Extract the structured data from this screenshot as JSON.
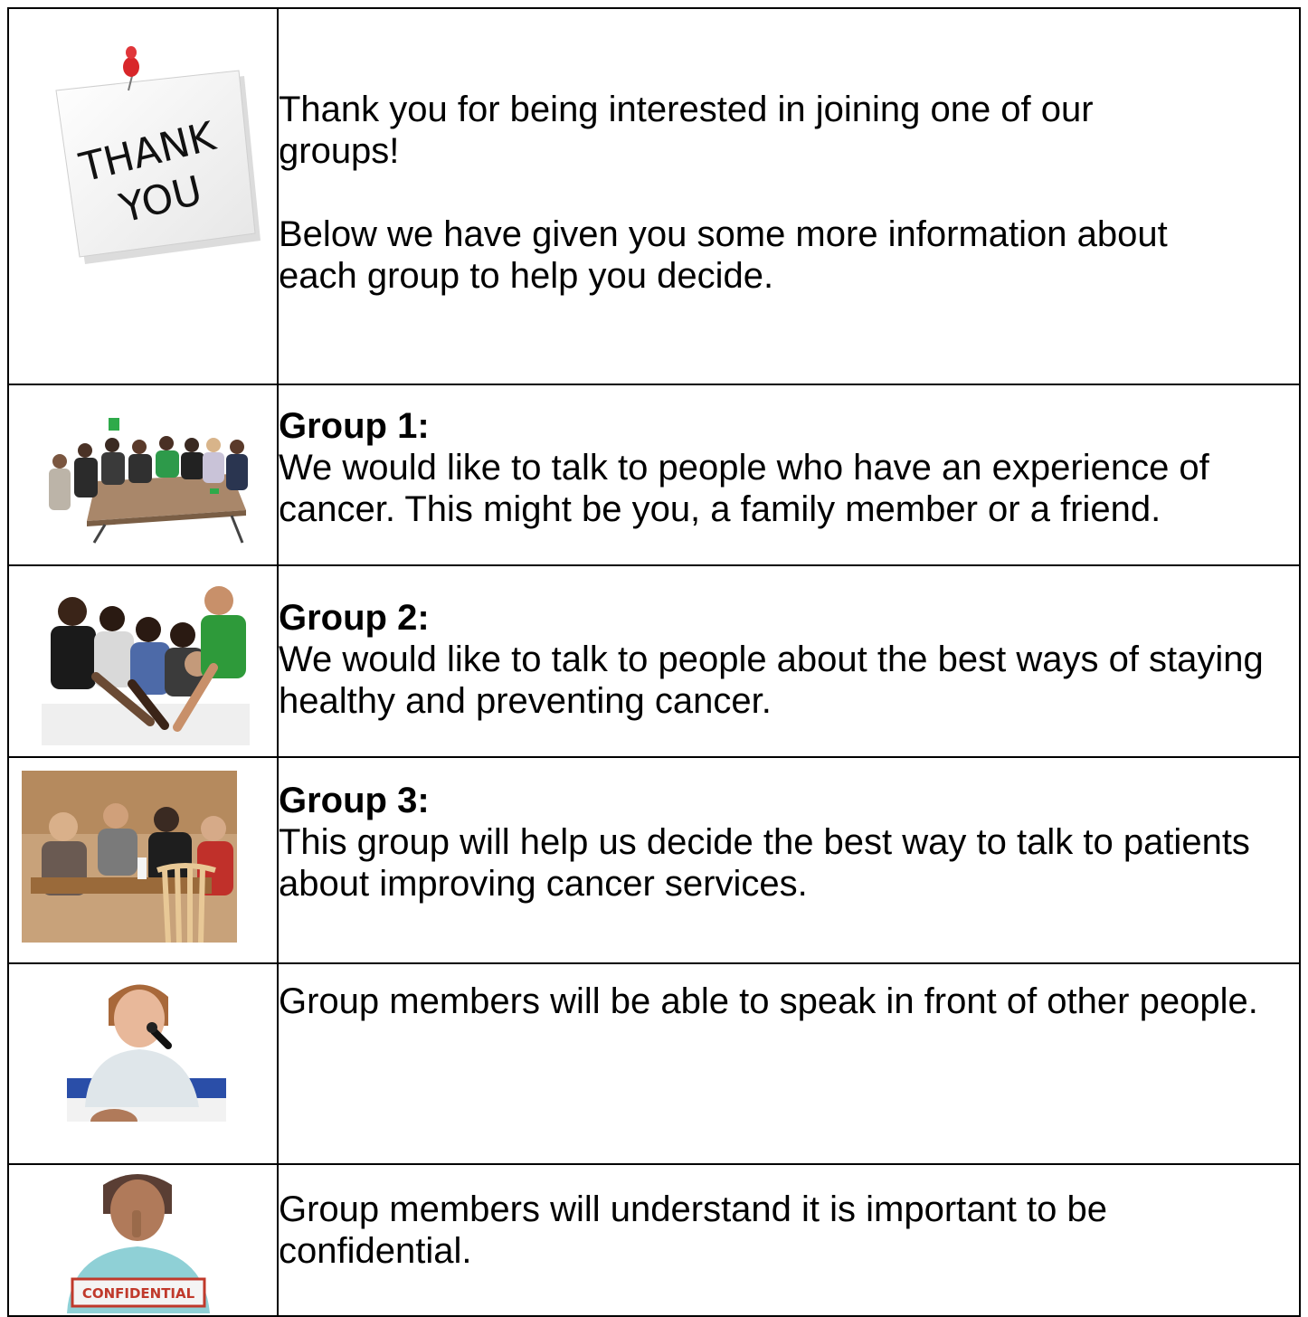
{
  "rows": [
    {
      "image": "thank-you-note",
      "note_text": [
        "THANK",
        "YOU"
      ],
      "heading": "",
      "paragraphs": [
        "Thank you for being interested in joining one of our groups!",
        "Below we have given you some more information about each group to help you decide."
      ]
    },
    {
      "image": "meeting-table-photo",
      "heading": "Group 1:",
      "text": "We would like to talk to people who have an experience of cancer. This might be you, a family member or a friend."
    },
    {
      "image": "group-hands-photo",
      "heading": "Group 2:",
      "text": "We would like to talk to people about the best ways of staying healthy and preventing cancer."
    },
    {
      "image": "cafe-table-photo",
      "heading": "Group 3:",
      "text": "This group will help us decide the best way to talk to patients about improving cancer services."
    },
    {
      "image": "woman-speaking-microphone-photo",
      "heading": "",
      "text": "Group members will be able to speak in front of other people."
    },
    {
      "image": "confidential-sign-photo",
      "sign_text": "CONFIDENTIAL",
      "heading": "",
      "text": "Group members will understand it is important to be confidential."
    }
  ],
  "colors": {
    "border": "#000000",
    "pin": "#d8262a",
    "sign_red": "#c0392b"
  }
}
